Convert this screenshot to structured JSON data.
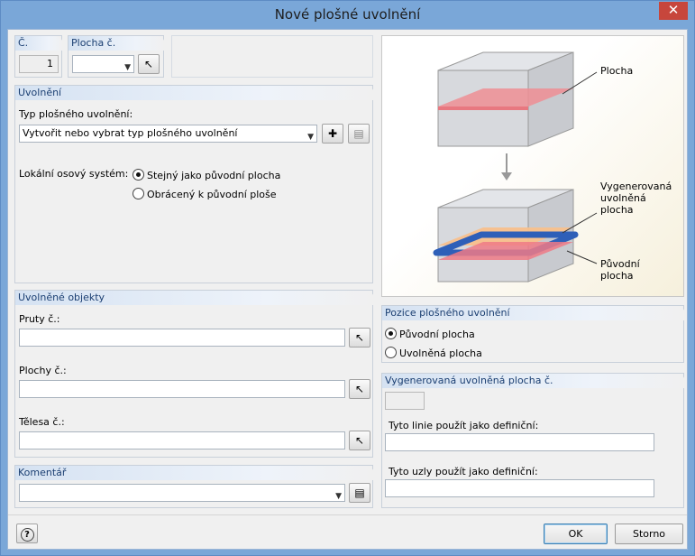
{
  "window": {
    "title": "Nové plošné uvolnění",
    "close": "✕"
  },
  "top": {
    "no_label": "Č.",
    "no_value": "1",
    "surface_label": "Plocha č.",
    "surface_value": ""
  },
  "release": {
    "header": "Uvolnění",
    "type_label": "Typ plošného uvolnění:",
    "type_value": "Vytvořit nebo vybrat typ plošného uvolnění",
    "axis_label": "Lokální osový systém:",
    "axis_opt1": "Stejný jako původní plocha",
    "axis_opt2": "Obrácený k původní ploše",
    "axis_selected": "Stejný jako původní plocha"
  },
  "objects": {
    "header": "Uvolněné objekty",
    "members_label": "Pruty č.:",
    "members_value": "",
    "surfaces_label": "Plochy č.:",
    "surfaces_value": "",
    "solids_label": "Tělesa č.:",
    "solids_value": ""
  },
  "comment": {
    "header": "Komentář",
    "value": ""
  },
  "figure": {
    "surface": "Plocha",
    "generated": "Vygenerovaná\nuvolněná\nplocha",
    "original": "Původní\nplocha"
  },
  "position": {
    "header": "Pozice plošného uvolnění",
    "opt1": "Původní plocha",
    "opt2": "Uvolněná plocha",
    "selected": "Původní plocha"
  },
  "generated": {
    "header": "Vygenerovaná uvolněná plocha č.",
    "value": "",
    "lines_label": "Tyto linie použít jako definiční:",
    "lines_value": "",
    "nodes_label": "Tyto uzly použít jako definiční:",
    "nodes_value": ""
  },
  "buttons": {
    "ok": "OK",
    "cancel": "Storno",
    "help": "?"
  }
}
